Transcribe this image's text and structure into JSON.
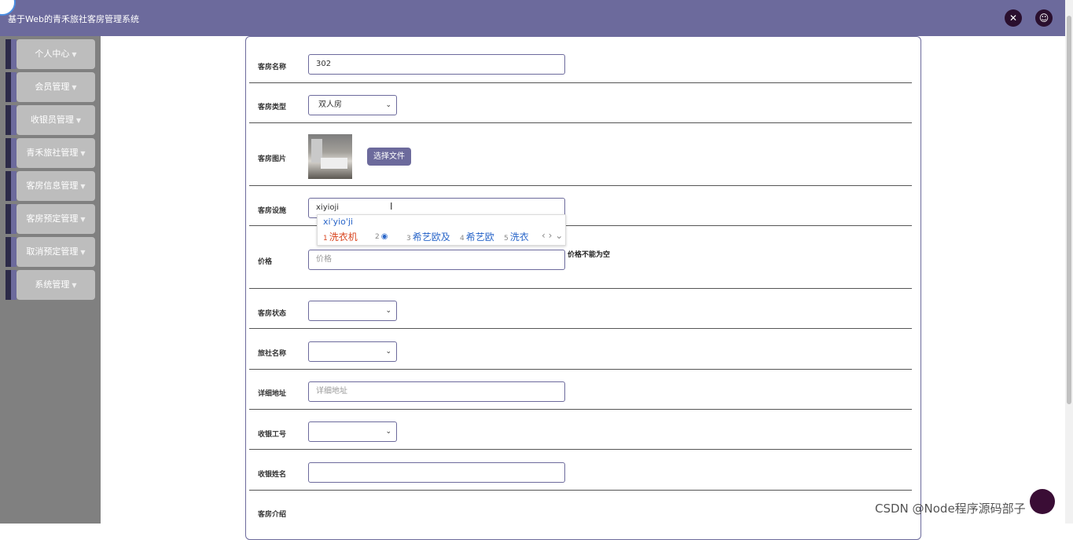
{
  "header": {
    "title": "基于Web的青禾旅社客房管理系统",
    "fullscreen_icon": "expand-icon",
    "user_icon": "user-icon"
  },
  "sidebar": {
    "items": [
      {
        "label": "个人中心"
      },
      {
        "label": "会员管理"
      },
      {
        "label": "收银员管理"
      },
      {
        "label": "青禾旅社管理"
      },
      {
        "label": "客房信息管理"
      },
      {
        "label": "客房预定管理"
      },
      {
        "label": "取消预定管理"
      },
      {
        "label": "系统管理"
      }
    ]
  },
  "form": {
    "room_name": {
      "label": "客房名称",
      "value": "302"
    },
    "room_type": {
      "label": "客房类型",
      "value": "双人房"
    },
    "room_image": {
      "label": "客房图片",
      "button": "选择文件"
    },
    "room_facilities": {
      "label": "客房设施",
      "value": "xiyioji"
    },
    "price": {
      "label": "价格",
      "placeholder": "价格",
      "error": "价格不能为空"
    },
    "room_status": {
      "label": "客房状态",
      "value": ""
    },
    "hostel_name": {
      "label": "旅社名称",
      "value": ""
    },
    "address": {
      "label": "详细地址",
      "placeholder": "详细地址"
    },
    "cashier_id": {
      "label": "收银工号",
      "value": ""
    },
    "cashier_name": {
      "label": "收银姓名",
      "value": ""
    },
    "room_intro": {
      "label": "客房介绍"
    }
  },
  "ime": {
    "composition": "xi'yio'ji",
    "candidates": [
      {
        "n": "1",
        "text": "洗衣机"
      },
      {
        "n": "2",
        "text": ""
      },
      {
        "n": "3",
        "text": "希艺欧及"
      },
      {
        "n": "4",
        "text": "希艺欧"
      },
      {
        "n": "5",
        "text": "洗衣"
      }
    ]
  },
  "watermark": "CSDN @Node程序源码部子"
}
